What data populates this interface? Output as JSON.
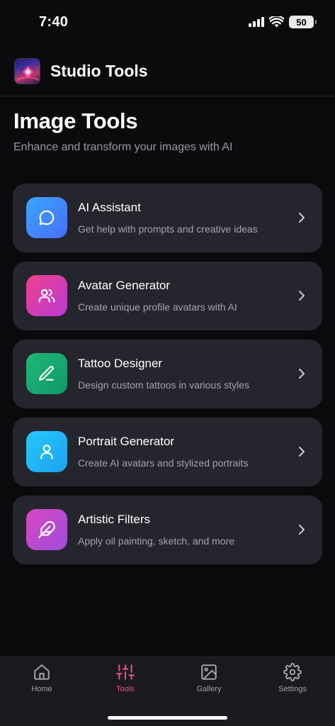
{
  "status_bar": {
    "time": "7:40",
    "battery": "50"
  },
  "header": {
    "title": "Studio Tools",
    "logo_icon": "sparkle-logo-icon"
  },
  "page": {
    "title": "Image Tools",
    "subtitle": "Enhance and transform your images with AI"
  },
  "tools": [
    {
      "name": "AI Assistant",
      "description": "Get help with prompts and creative ideas",
      "icon": "chat-bubble-icon",
      "gradient": [
        "#39a7ff",
        "#4a6cf7"
      ]
    },
    {
      "name": "Avatar Generator",
      "description": "Create unique profile avatars with AI",
      "icon": "users-icon",
      "gradient": [
        "#f0418a",
        "#b93ad4"
      ]
    },
    {
      "name": "Tattoo Designer",
      "description": "Design custom tattoos in various styles",
      "icon": "pen-icon",
      "gradient": [
        "#1fb877",
        "#11996a"
      ]
    },
    {
      "name": "Portrait Generator",
      "description": "Create AI avatars and stylized portraits",
      "icon": "person-icon",
      "gradient": [
        "#27c7f9",
        "#1aa3f0"
      ]
    },
    {
      "name": "Artistic Filters",
      "description": "Apply oil painting, sketch, and more",
      "icon": "feather-icon",
      "gradient": [
        "#d946c0",
        "#9d4edd"
      ]
    }
  ],
  "tab_bar": {
    "items": [
      {
        "label": "Home",
        "icon": "home-icon",
        "active": false
      },
      {
        "label": "Tools",
        "icon": "sliders-icon",
        "active": true
      },
      {
        "label": "Gallery",
        "icon": "image-icon",
        "active": false
      },
      {
        "label": "Settings",
        "icon": "gear-icon",
        "active": false
      }
    ],
    "active_color": "#ec4a8f",
    "inactive_color": "#a0a0a8"
  }
}
